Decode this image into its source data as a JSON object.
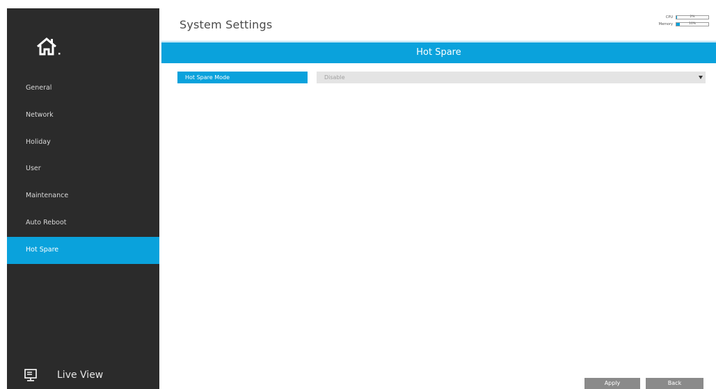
{
  "header": {
    "title": "System Settings",
    "stats": {
      "cpu_label": "CPU",
      "cpu_value": "2%",
      "cpu_fraction": 0.02,
      "memory_label": "Memory",
      "memory_value": "10%",
      "memory_fraction": 0.1
    }
  },
  "sidebar": {
    "home_icon": "home-icon",
    "items": [
      {
        "label": "General",
        "active": false
      },
      {
        "label": "Network",
        "active": false
      },
      {
        "label": "Holiday",
        "active": false
      },
      {
        "label": "User",
        "active": false
      },
      {
        "label": "Maintenance",
        "active": false
      },
      {
        "label": "Auto Reboot",
        "active": false
      },
      {
        "label": "Hot Spare",
        "active": true
      }
    ],
    "live_view": {
      "label": "Live View",
      "icon": "monitor-icon"
    }
  },
  "main": {
    "section_title": "Hot Spare",
    "form": {
      "hot_spare_mode_label": "Hot Spare Mode",
      "hot_spare_mode_value": "Disable"
    }
  },
  "footer": {
    "apply_label": "Apply",
    "back_label": "Back"
  },
  "colors": {
    "accent": "#0aa2dc",
    "sidebar_bg": "#2b2b2b",
    "button_bg": "#8a8a8a",
    "select_bg": "#e4e4e4"
  }
}
